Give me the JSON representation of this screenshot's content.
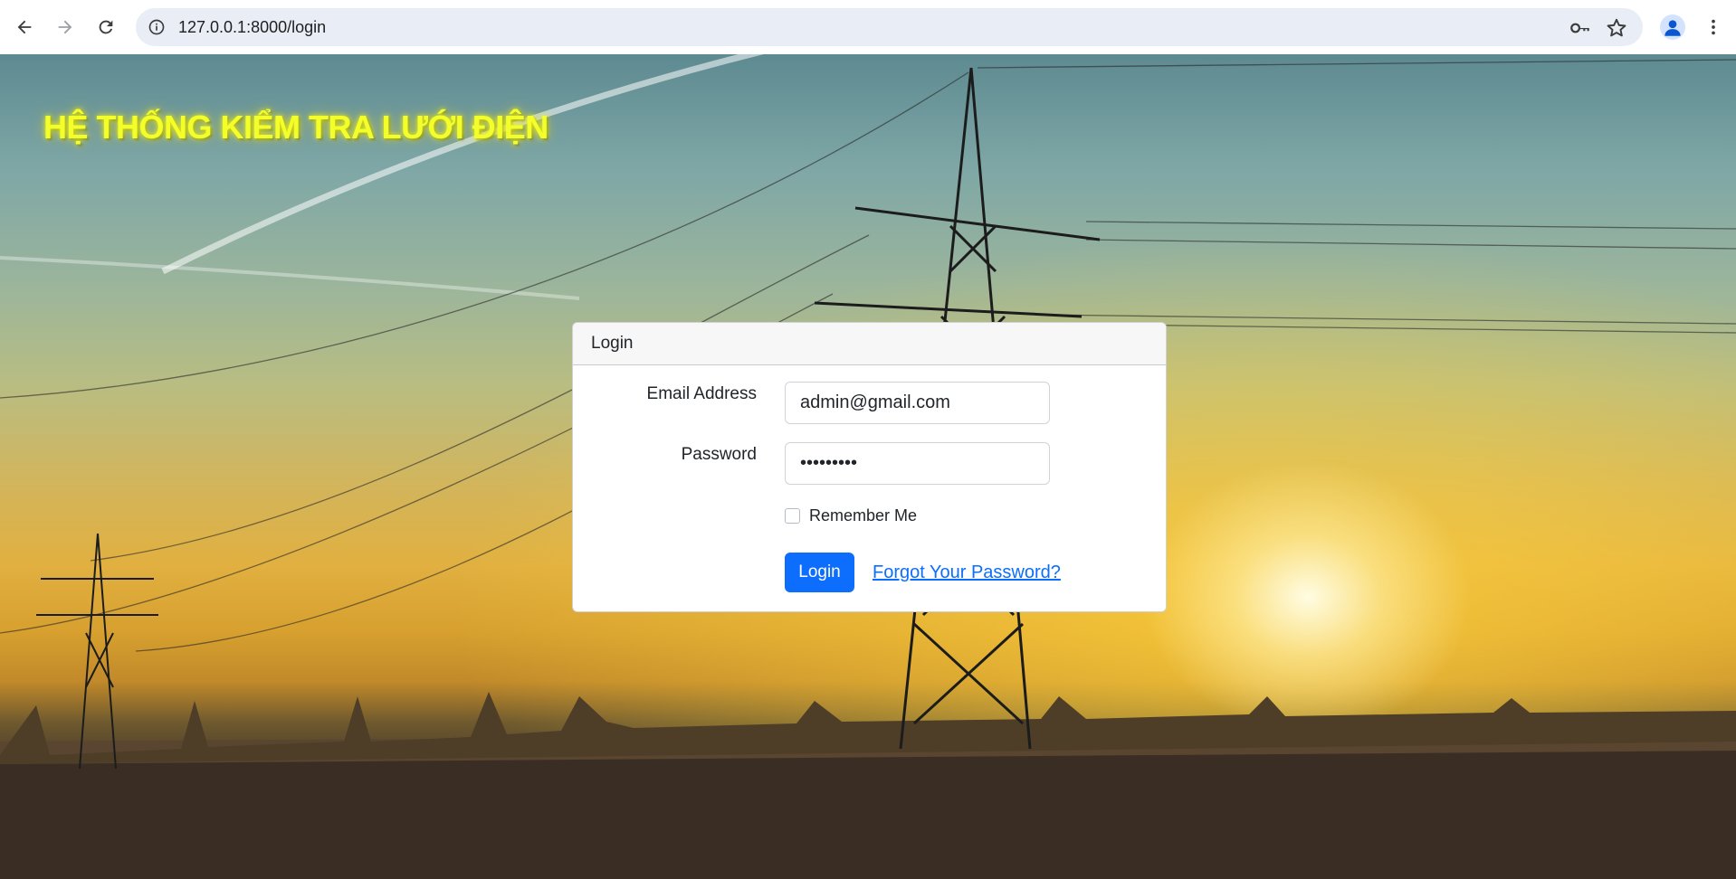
{
  "browser": {
    "url": "127.0.0.1:8000/login",
    "icons": {
      "back": "arrow-left-icon",
      "forward": "arrow-right-icon",
      "reload": "reload-icon",
      "site_info": "info-icon",
      "password": "key-icon",
      "bookmark": "star-icon",
      "profile": "person-icon",
      "menu": "kebab-menu-icon"
    }
  },
  "page": {
    "title": "HỆ THỐNG KIỂM TRA LƯỚI ĐIỆN",
    "title_color": "#f2ff2a"
  },
  "login": {
    "header": "Login",
    "email_label": "Email Address",
    "email_value": "admin@gmail.com",
    "password_label": "Password",
    "password_value": "•••••••••",
    "remember_label": "Remember Me",
    "remember_checked": false,
    "submit_label": "Login",
    "forgot_label": "Forgot Your Password?",
    "primary_color": "#0d6efd"
  }
}
